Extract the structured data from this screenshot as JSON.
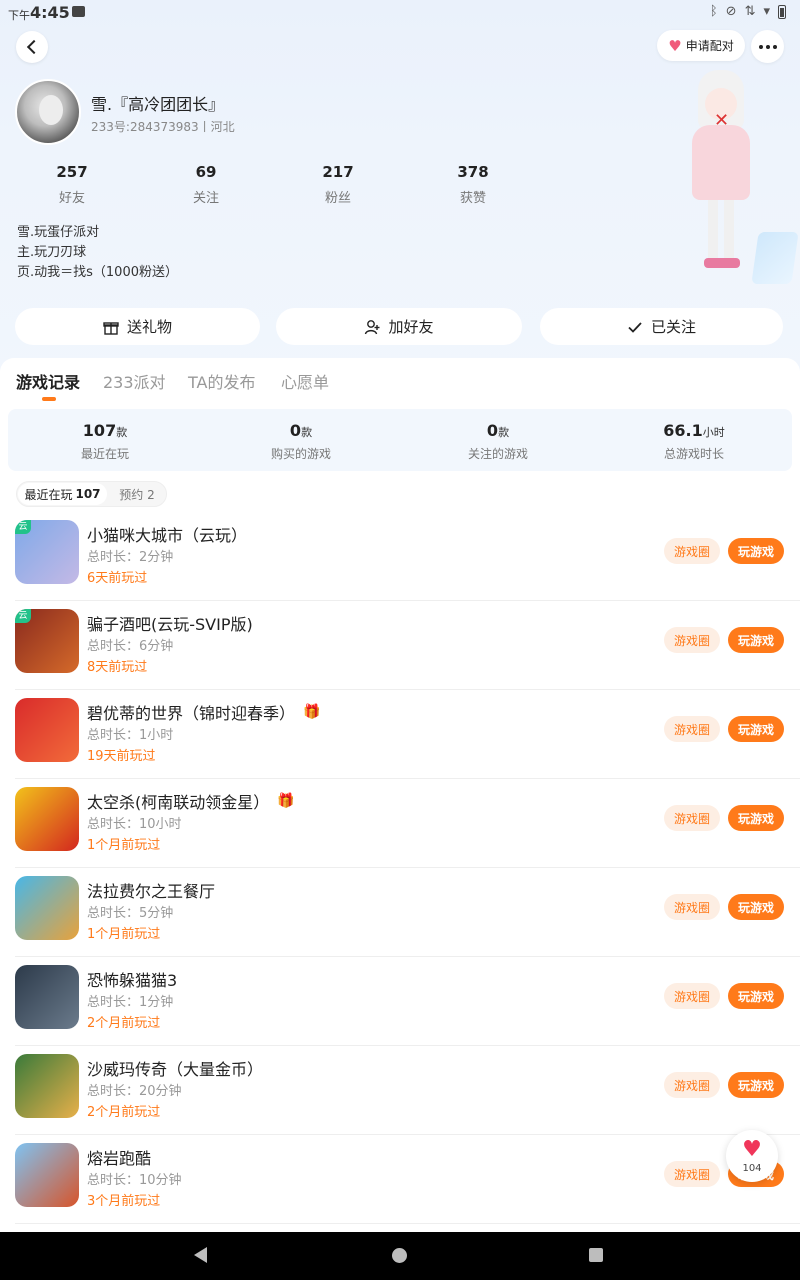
{
  "status_bar": {
    "time_prefix": "下午",
    "time": "4:45"
  },
  "header": {
    "pair_label": "申请配对"
  },
  "profile": {
    "nickname": "雪.『高冷团团长』",
    "id_line": "233号:284373983丨河北",
    "stats": [
      {
        "value": "257",
        "label": "好友"
      },
      {
        "value": "69",
        "label": "关注"
      },
      {
        "value": "217",
        "label": "粉丝"
      },
      {
        "value": "378",
        "label": "获赞"
      }
    ],
    "bio": [
      "雪.玩蛋仔派对",
      "主.玩刀刃球",
      "页.动我＝找s（1000粉送）"
    ]
  },
  "actions": {
    "gift": "送礼物",
    "add_friend": "加好友",
    "followed": "已关注"
  },
  "tabs": [
    {
      "label": "游戏记录"
    },
    {
      "label": "233派对"
    },
    {
      "label": "TA的发布"
    },
    {
      "label": "心愿单"
    }
  ],
  "summary": [
    {
      "value": "107",
      "unit": "款",
      "label": "最近在玩"
    },
    {
      "value": "0",
      "unit": "款",
      "label": "购买的游戏"
    },
    {
      "value": "0",
      "unit": "款",
      "label": "关注的游戏"
    },
    {
      "value": "66.1",
      "unit": "小时",
      "label": "总游戏时长"
    }
  ],
  "filter": {
    "recent_label": "最近在玩",
    "recent_count": "107",
    "reserve_label": "预约 2"
  },
  "games": [
    {
      "name": "小猫咪大城市（云玩）",
      "time": "总时长：2分钟",
      "last": "6天前玩过",
      "cloud": "云",
      "gift": false,
      "colors": [
        "#7fa9e8",
        "#c4b9e6"
      ]
    },
    {
      "name": "骗子酒吧(云玩-SVIP版)",
      "time": "总时长：6分钟",
      "last": "8天前玩过",
      "cloud": "云",
      "gift": false,
      "colors": [
        "#8a2a1e",
        "#d56a2a"
      ]
    },
    {
      "name": "碧优蒂的世界（锦时迎春季）",
      "time": "总时长：1小时",
      "last": "19天前玩过",
      "cloud": "",
      "gift": true,
      "colors": [
        "#d92b2b",
        "#f26b3a"
      ]
    },
    {
      "name": "太空杀(柯南联动领金星）",
      "time": "总时长：10小时",
      "last": "1个月前玩过",
      "cloud": "",
      "gift": true,
      "colors": [
        "#f2c21b",
        "#d3271f"
      ]
    },
    {
      "name": "法拉费尔之王餐厅",
      "time": "总时长：5分钟",
      "last": "1个月前玩过",
      "cloud": "",
      "gift": false,
      "colors": [
        "#48b7e8",
        "#e8a23b"
      ]
    },
    {
      "name": "恐怖躲猫猫3",
      "time": "总时长：1分钟",
      "last": "2个月前玩过",
      "cloud": "",
      "gift": false,
      "colors": [
        "#2c3a4a",
        "#6b7b8c"
      ]
    },
    {
      "name": "沙威玛传奇（大量金币）",
      "time": "总时长：20分钟",
      "last": "2个月前玩过",
      "cloud": "",
      "gift": false,
      "colors": [
        "#3a7a3a",
        "#e8b04a"
      ]
    },
    {
      "name": "熔岩跑酷",
      "time": "总时长：10分钟",
      "last": "3个月前玩过",
      "cloud": "",
      "gift": false,
      "colors": [
        "#7fc3f2",
        "#d7542a"
      ]
    }
  ],
  "row_buttons": {
    "circle": "游戏圈",
    "play": "玩游戏"
  },
  "like_float": {
    "count": "104"
  },
  "icons": [
    "back-icon",
    "heart-icon",
    "more-icon",
    "gift-icon",
    "add-user-icon",
    "check-icon",
    "like-heart-icon"
  ]
}
